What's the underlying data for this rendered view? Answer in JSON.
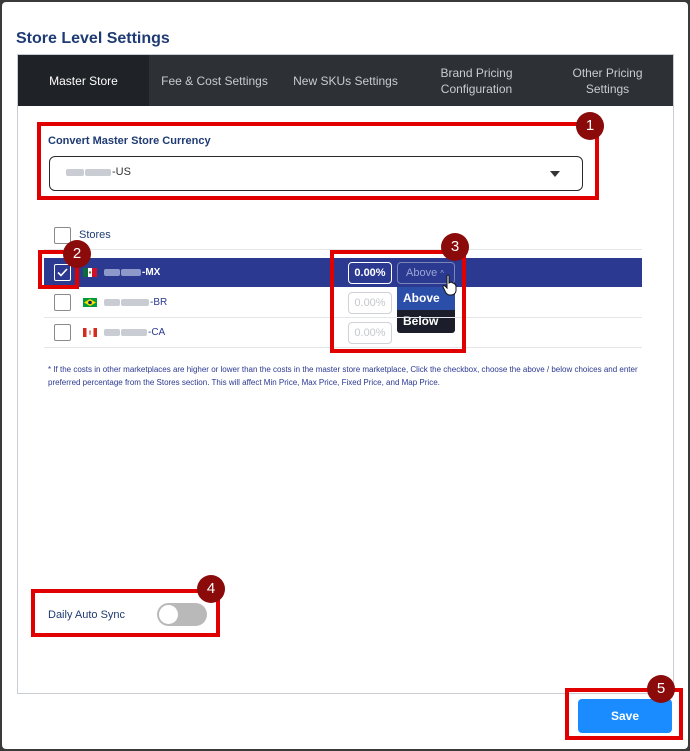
{
  "modal": {
    "title": "Store Level Settings"
  },
  "tabs": [
    {
      "label": "Master Store",
      "active": true
    },
    {
      "label": "Fee & Cost Settings"
    },
    {
      "label": "New SKUs Settings"
    },
    {
      "label": "Brand Pricing\nConfiguration"
    },
    {
      "label": "Other Pricing\nSettings"
    }
  ],
  "currency": {
    "label": "Convert Master Store Currency",
    "selected_suffix": "-US"
  },
  "stores": {
    "header": "Stores",
    "rows": [
      {
        "suffix": "-MX",
        "percent": "0.00%",
        "checked": true,
        "flag": "mexico-flag-icon"
      },
      {
        "suffix": "-BR",
        "percent": "0.00%",
        "checked": false,
        "flag": "brazil-flag-icon"
      },
      {
        "suffix": "-CA",
        "percent": "0.00%",
        "checked": false,
        "flag": "canada-flag-icon"
      }
    ]
  },
  "direction": {
    "current": "Above",
    "options": [
      "Above",
      "Below"
    ]
  },
  "note": "* If the costs in other marketplaces are higher or lower than the costs in the master store marketplace, Click the checkbox, choose the above / below choices and enter preferred percentage from the Stores section. This will affect Min Price, Max Price, Fixed Price, and Map Price.",
  "sync": {
    "label": "Daily Auto Sync",
    "enabled": false
  },
  "save_label": "Save",
  "markers": [
    "1",
    "2",
    "3",
    "4",
    "5"
  ],
  "colors": {
    "accent": "#2b3990",
    "save": "#1a8cff",
    "highlight": "#e00000",
    "marker": "#8b0a0a"
  }
}
